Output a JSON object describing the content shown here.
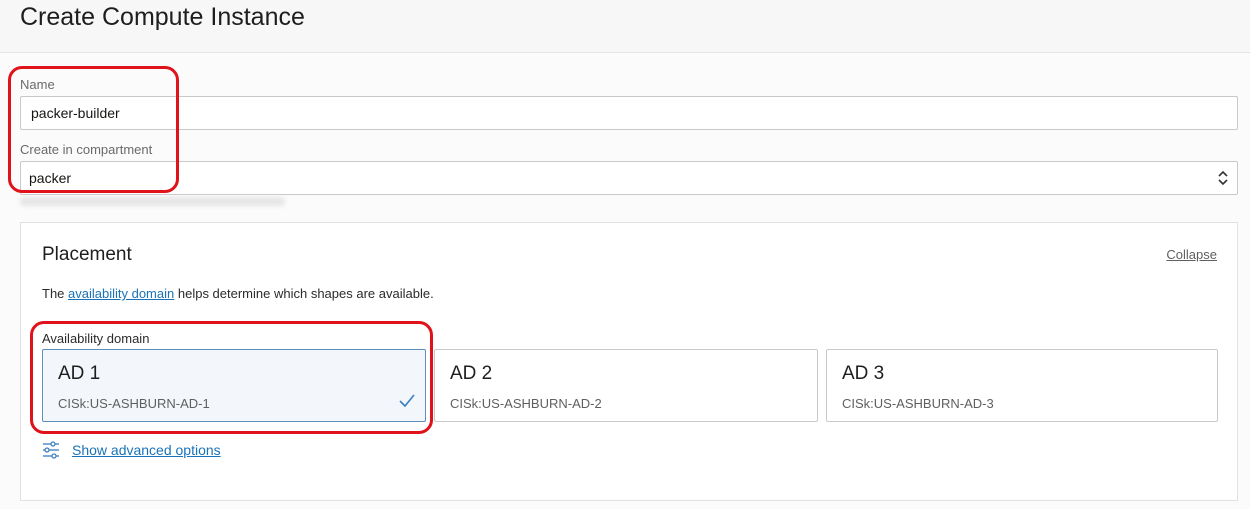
{
  "header": {
    "title": "Create Compute Instance"
  },
  "name_field": {
    "label": "Name",
    "value": "packer-builder"
  },
  "compartment_field": {
    "label": "Create in compartment",
    "value": "packer"
  },
  "placement": {
    "title": "Placement",
    "collapse_label": "Collapse",
    "help_prefix": "The ",
    "help_link": "availability domain",
    "help_suffix": " helps determine which shapes are available.",
    "ad_label": "Availability domain",
    "domains": [
      {
        "name": "AD 1",
        "id": "CISk:US-ASHBURN-AD-1",
        "selected": true
      },
      {
        "name": "AD 2",
        "id": "CISk:US-ASHBURN-AD-2",
        "selected": false
      },
      {
        "name": "AD 3",
        "id": "CISk:US-ASHBURN-AD-3",
        "selected": false
      }
    ],
    "advanced_link": "Show advanced options"
  },
  "colors": {
    "annotation": "#e0121a",
    "link": "#1a73b8",
    "selected_border": "#5c8fbd",
    "selected_bg": "#f3f7fb"
  },
  "icons": {
    "select": "chevron-up-down-icon",
    "check": "checkmark-icon",
    "advanced": "sliders-icon"
  }
}
